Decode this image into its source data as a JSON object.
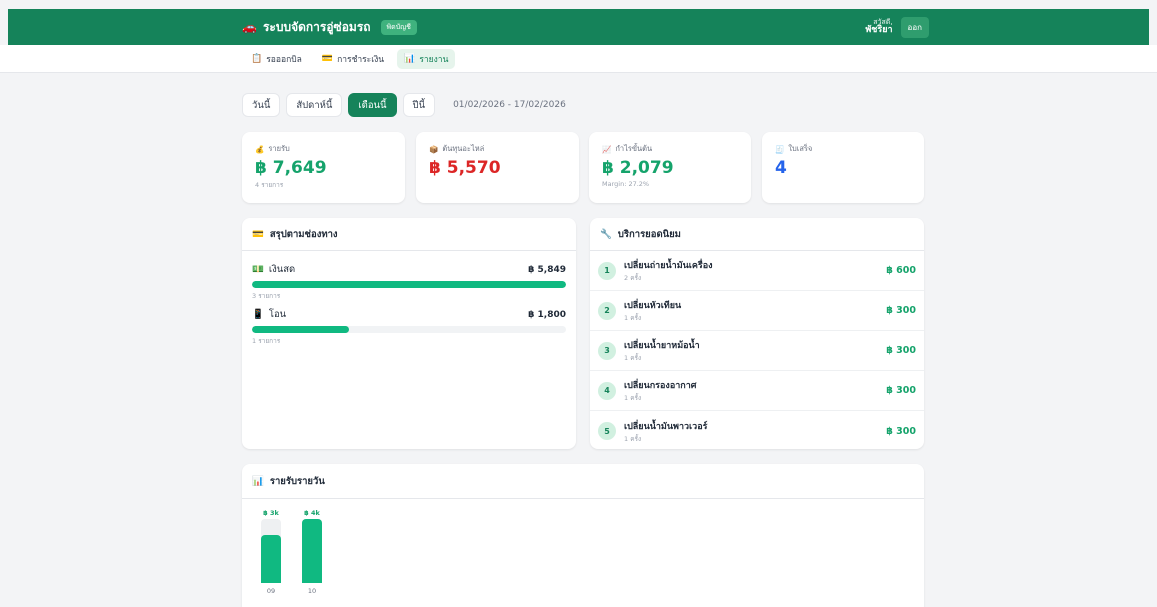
{
  "header": {
    "car_icon": "car-icon",
    "title": "ระบบจัดการอู่ซ่อมรถ",
    "role_badge": "พิดบัญชี",
    "greeting": "สวัสดี,",
    "user_name": "พัชริยา",
    "logout_label": "ออก"
  },
  "subnav": {
    "tabs": [
      {
        "label": "รอออกบิล",
        "icon": "clipboard-icon"
      },
      {
        "label": "การชำระเงิน",
        "icon": "card-icon"
      },
      {
        "label": "รายงาน",
        "icon": "chart-icon",
        "active": true
      }
    ]
  },
  "period": {
    "buttons": [
      "วันนี้",
      "สัปดาห์นี้",
      "เดือนนี้",
      "ปีนี้"
    ],
    "active": "เดือนนี้",
    "date_range": "01/02/2026 - 17/02/2026"
  },
  "stats": [
    {
      "label": "รายรับ",
      "value": "฿ 7,649",
      "sub": "4 รายการ",
      "icon": "money-bag-icon",
      "color": "#15a36b"
    },
    {
      "label": "ต้นทุนอะไหล่",
      "value": "฿ 5,570",
      "sub": "",
      "icon": "box-icon",
      "color": "#dc2626"
    },
    {
      "label": "กำไรขั้นต้น",
      "value": "฿ 2,079",
      "sub": "Margin: 27.2%",
      "icon": "chart-up-icon",
      "color": "#15a36b"
    },
    {
      "label": "ใบเสร็จ",
      "value": "4",
      "sub": "",
      "icon": "receipt-icon",
      "color": "#2563eb"
    }
  ],
  "channels": {
    "title": "สรุปตามช่องทาง",
    "items": [
      {
        "name": "เงินสด",
        "amount": "฿ 5,849",
        "count": "3 รายการ",
        "share": 1.0,
        "icon": "cash-icon"
      },
      {
        "name": "โอน",
        "amount": "฿ 1,800",
        "count": "1 รายการ",
        "share": 0.31,
        "icon": "phone-icon"
      }
    ]
  },
  "top_services": {
    "title": "บริการยอดนิยม",
    "items": [
      {
        "rank": "1",
        "name": "เปลี่ยนถ่ายน้ำมันเครื่อง",
        "count": "2 ครั้ง",
        "price": "฿ 600"
      },
      {
        "rank": "2",
        "name": "เปลี่ยนหัวเทียน",
        "count": "1 ครั้ง",
        "price": "฿ 300"
      },
      {
        "rank": "3",
        "name": "เปลี่ยนน้ำยาหม้อน้ำ",
        "count": "1 ครั้ง",
        "price": "฿ 300"
      },
      {
        "rank": "4",
        "name": "เปลี่ยนกรองอากาศ",
        "count": "1 ครั้ง",
        "price": "฿ 300"
      },
      {
        "rank": "5",
        "name": "เปลี่ยนน้ำมันพาวเวอร์",
        "count": "1 ครั้ง",
        "price": "฿ 300"
      }
    ]
  },
  "daily": {
    "title": "รายรับรายวัน"
  },
  "chart_data": {
    "type": "bar",
    "title": "รายรับรายวัน",
    "categories": [
      "09",
      "10"
    ],
    "values": [
      3000,
      4000
    ],
    "data_labels": [
      "฿ 3k",
      "฿ 4k"
    ],
    "ylim": [
      0,
      4000
    ],
    "grid": false
  }
}
